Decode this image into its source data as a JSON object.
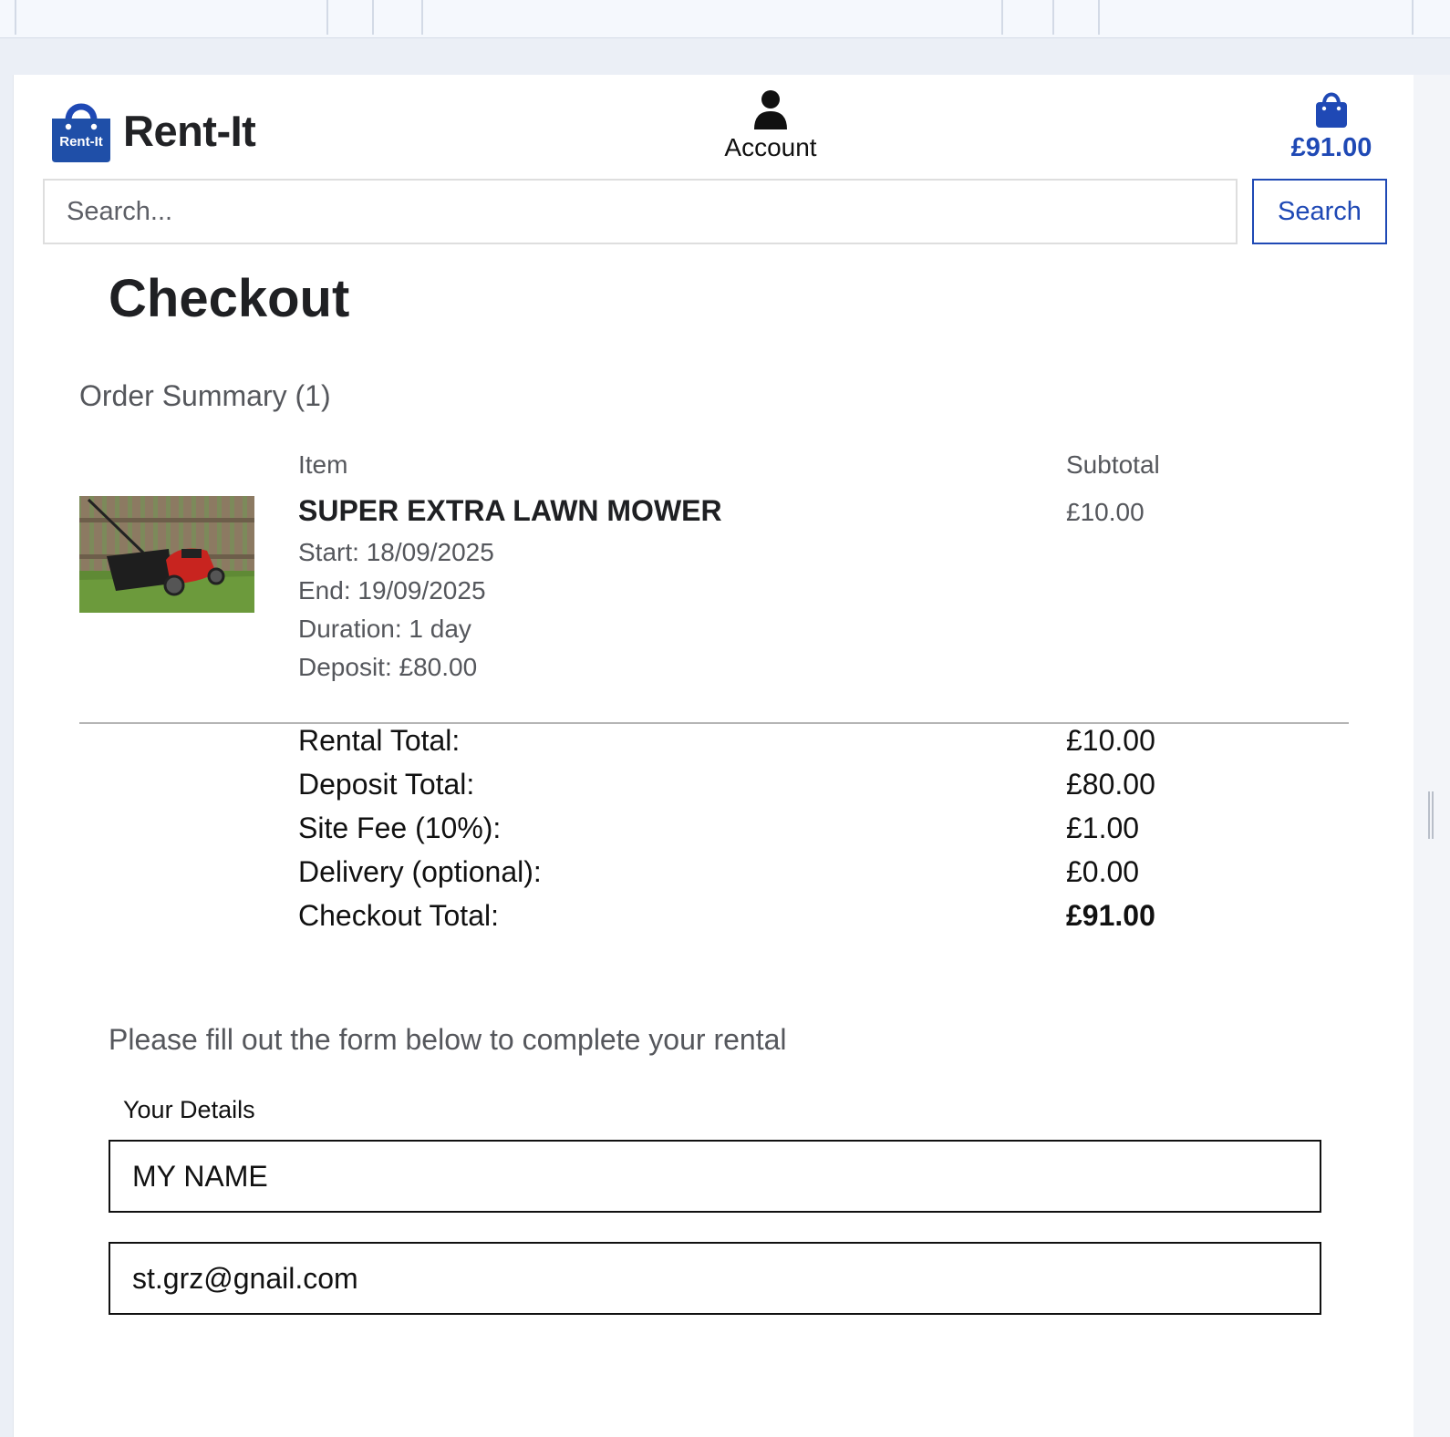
{
  "header": {
    "logo_text": "Rent-It",
    "brand": "Rent-It",
    "account_label": "Account",
    "cart_total": "£91.00",
    "accent_color": "#1f49b5"
  },
  "search": {
    "placeholder": "Search...",
    "button_label": "Search"
  },
  "page": {
    "title": "Checkout"
  },
  "order": {
    "summary_title": "Order Summary (1)",
    "columns": {
      "item": "Item",
      "subtotal": "Subtotal"
    },
    "item": {
      "name": "SUPER EXTRA LAWN MOWER",
      "start": "Start: 18/09/2025",
      "end": "End: 19/09/2025",
      "duration": "Duration: 1 day",
      "deposit": "Deposit: £80.00",
      "subtotal": "£10.00"
    },
    "totals": [
      {
        "label": "Rental Total:",
        "value": "£10.00"
      },
      {
        "label": "Deposit Total:",
        "value": "£80.00"
      },
      {
        "label": "Site Fee (10%):",
        "value": "£1.00"
      },
      {
        "label": "Delivery (optional):",
        "value": "£0.00"
      },
      {
        "label": "Checkout Total:",
        "value": "£91.00"
      }
    ]
  },
  "form": {
    "intro": "Please fill out the form below to complete your rental",
    "section_label": "Your Details",
    "name_value": "MY NAME",
    "email_value": "st.grz@gnail.com"
  }
}
